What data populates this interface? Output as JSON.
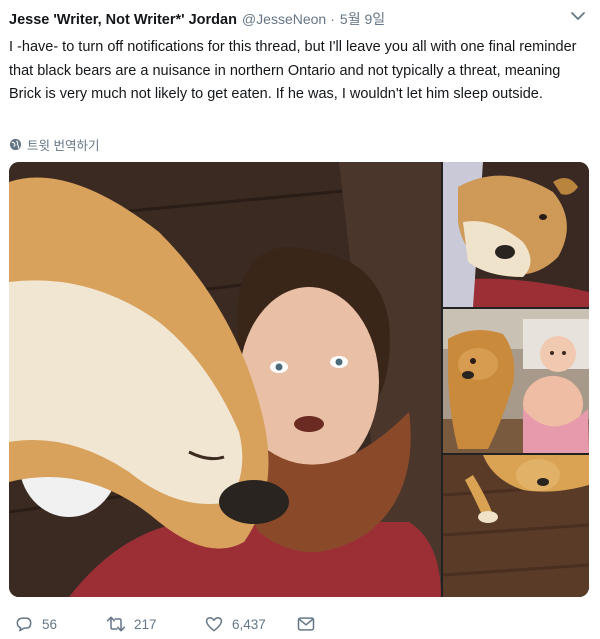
{
  "tweet": {
    "author_name": "Jesse 'Writer, Not Writer*' Jordan",
    "handle": "@JesseNeon",
    "separator": "·",
    "date": "5월 9일",
    "text": "I -have- to turn off notifications for this thread, but I'll leave you all with  one final reminder that black bears are a nuisance in northern Ontario and not typically a threat, meaning Brick is very much not likely to get eaten. If he was, I wouldn't let him sleep outside.",
    "translate_label": "트윗 번역하기"
  },
  "media": {
    "photos": [
      {
        "subject": "selfie with dog"
      },
      {
        "subject": "dog lying down"
      },
      {
        "subject": "dog and baby"
      },
      {
        "subject": "dog on floor"
      }
    ]
  },
  "actions": {
    "replies": "56",
    "retweets": "217",
    "likes": "6,437"
  },
  "icons": [
    "chevron-down-icon",
    "globe-icon",
    "reply-icon",
    "retweet-icon",
    "like-icon",
    "message-icon"
  ],
  "colors": {
    "text": "#14171a",
    "secondary": "#657786"
  }
}
